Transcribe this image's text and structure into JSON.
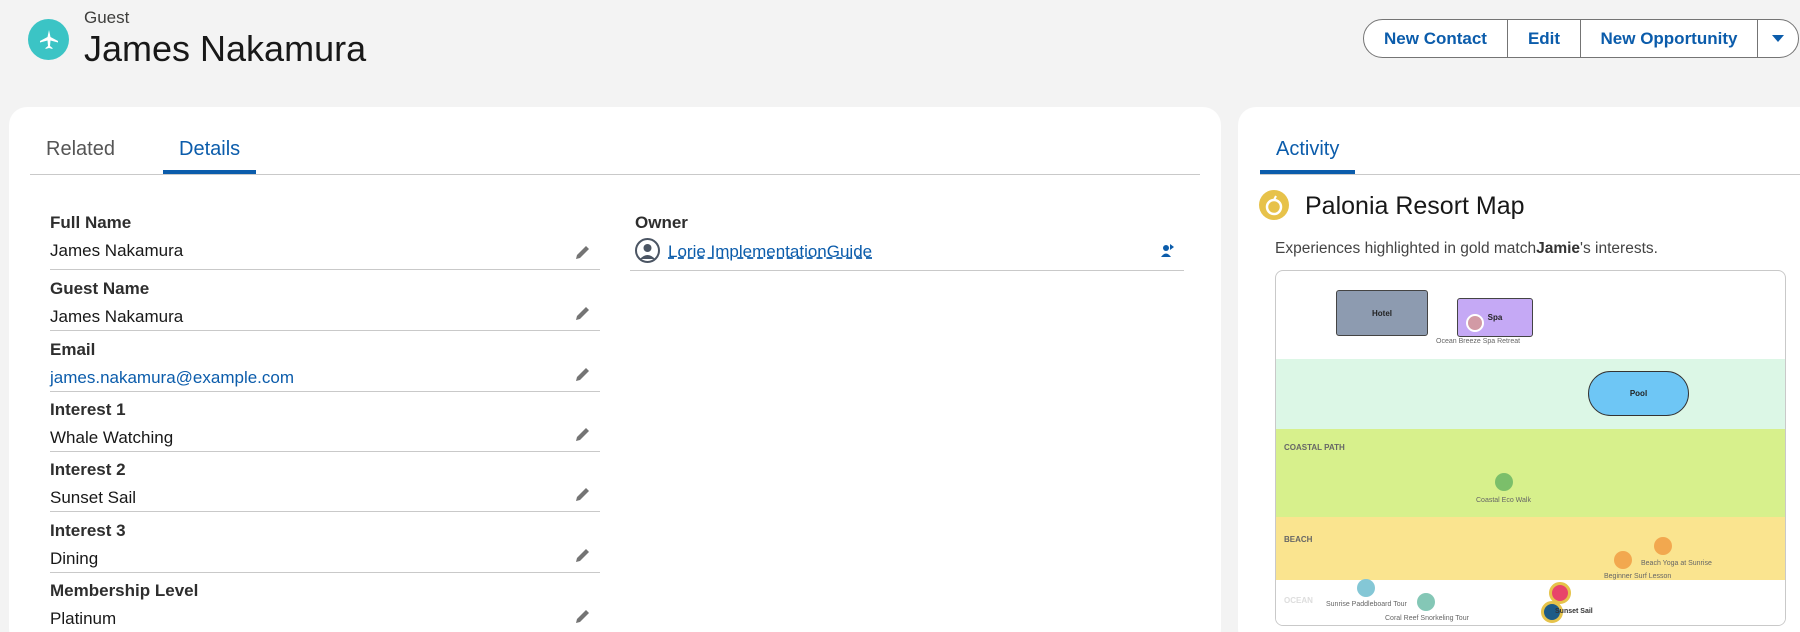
{
  "header": {
    "record_type": "Guest",
    "name": "James Nakamura",
    "buttons": [
      "New Contact",
      "Edit",
      "New Opportunity"
    ],
    "icon": "airplane-icon"
  },
  "tabs_left": [
    {
      "label": "Related",
      "active": false
    },
    {
      "label": "Details",
      "active": true
    }
  ],
  "fields": [
    {
      "label": "Full Name",
      "value": "James Nakamura",
      "link": false
    },
    {
      "label": "Guest Name",
      "value": "James Nakamura",
      "link": false
    },
    {
      "label": "Email",
      "value": "james.nakamura@example.com",
      "link": true
    },
    {
      "label": "Interest 1",
      "value": "Whale Watching",
      "link": false
    },
    {
      "label": "Interest 2",
      "value": "Sunset Sail",
      "link": false
    },
    {
      "label": "Interest 3",
      "value": "Dining",
      "link": false
    },
    {
      "label": "Membership Level",
      "value": "Platinum",
      "link": false
    }
  ],
  "owner": {
    "label": "Owner",
    "name": "Lorie ImplementationGuide"
  },
  "activity": {
    "tab": "Activity",
    "map_title": "Palonia Resort Map",
    "desc_prefix": "Experiences highlighted in gold match",
    "desc_name": "Jamie",
    "desc_suffix": "'s interests.",
    "map": {
      "buildings": [
        "Hotel",
        "Spa",
        "Pool"
      ],
      "zones": [
        "COASTAL PATH",
        "BEACH",
        "OCEAN"
      ],
      "experiences": [
        "Ocean Breeze Spa Retreat",
        "Coastal Eco Walk",
        "Beach Yoga at Sunrise",
        "Beginner Surf Lesson",
        "Sunrise Paddleboard Tour",
        "Coral Reef Snorkeling Tour",
        "Sunset Sail"
      ]
    }
  },
  "colors": {
    "brand": "#0b5cab",
    "guest_icon": "#3bc4c5",
    "map_icon": "#e7c24a",
    "highlight_gold": "#e6c34a"
  }
}
